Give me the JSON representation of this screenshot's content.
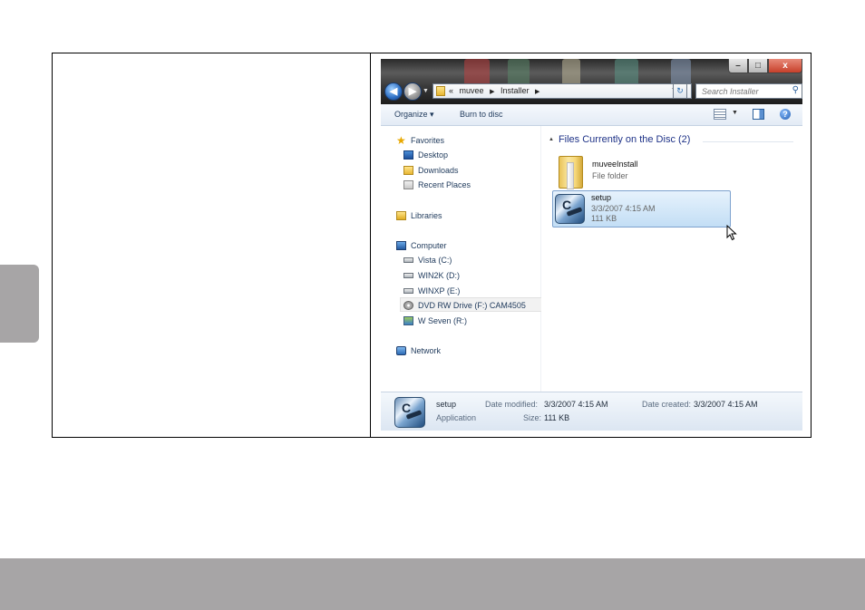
{
  "address": {
    "prefix": "«",
    "crumbs": [
      "muvee",
      "Installer"
    ],
    "search_placeholder": "Search Installer"
  },
  "window_controls": {
    "minimize": "–",
    "maximize": "□",
    "close": "x"
  },
  "toolbar": {
    "organize": "Organize ▾",
    "burn": "Burn to disc",
    "help": "?"
  },
  "nav": {
    "favorites": "Favorites",
    "desktop": "Desktop",
    "downloads": "Downloads",
    "recent_places": "Recent Places",
    "libraries": "Libraries",
    "computer": "Computer",
    "drives": [
      "Vista (C:)",
      "WIN2K (D:)",
      "WINXP (E:)"
    ],
    "dvd": "DVD RW Drive (F:) CAM4505",
    "wseven": "W Seven (R:)",
    "network": "Network"
  },
  "content": {
    "group_header": "Files Currently on the Disc (2)",
    "folder": {
      "name": "muveeInstall",
      "type": "File folder"
    },
    "setup": {
      "name": "setup",
      "date": "3/3/2007 4:15 AM",
      "size": "111 KB"
    }
  },
  "details": {
    "name": "setup",
    "type": "Application",
    "date_modified_label": "Date modified:",
    "date_modified": "3/3/2007 4:15 AM",
    "size_label": "Size:",
    "size": "111 KB",
    "date_created_label": "Date created:",
    "date_created": "3/3/2007 4:15 AM"
  }
}
